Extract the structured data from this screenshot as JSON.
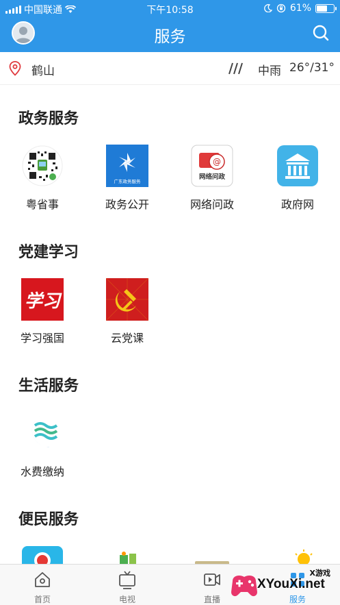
{
  "status_bar": {
    "carrier": "中国联通",
    "time": "下午10:58",
    "battery": "61%",
    "battery_level": 0.61
  },
  "header": {
    "title": "服务"
  },
  "weather": {
    "city": "鹤山",
    "condition": "中雨",
    "temperature": "26°/31°"
  },
  "sections": [
    {
      "title": "政务服务",
      "items": [
        {
          "label": "粤省事",
          "icon": "qr-code-icon"
        },
        {
          "label": "政务公开",
          "icon": "gov-open-icon",
          "icon_text": "广东政务服务"
        },
        {
          "label": "网络问政",
          "icon": "online-inquiry-icon",
          "icon_text": "网络问政"
        },
        {
          "label": "政府网",
          "icon": "government-building-icon"
        }
      ]
    },
    {
      "title": "党建学习",
      "items": [
        {
          "label": "学习强国",
          "icon": "xuexi-icon",
          "icon_text": "学习"
        },
        {
          "label": "云党课",
          "icon": "party-emblem-icon"
        }
      ]
    },
    {
      "title": "生活服务",
      "items": [
        {
          "label": "水费缴纳",
          "icon": "water-wave-icon"
        }
      ]
    },
    {
      "title": "便民服务",
      "items": []
    }
  ],
  "tab_bar": [
    {
      "label": "首页",
      "icon": "home-icon"
    },
    {
      "label": "电视",
      "icon": "tv-icon"
    },
    {
      "label": "直播",
      "icon": "video-icon"
    },
    {
      "label": "服务",
      "icon": "service-icon",
      "active": true
    }
  ],
  "watermark": {
    "cn": "X游戏",
    "en": "XYouXi.net"
  },
  "colors": {
    "primary": "#2f97e8",
    "red": "#d7171e"
  }
}
